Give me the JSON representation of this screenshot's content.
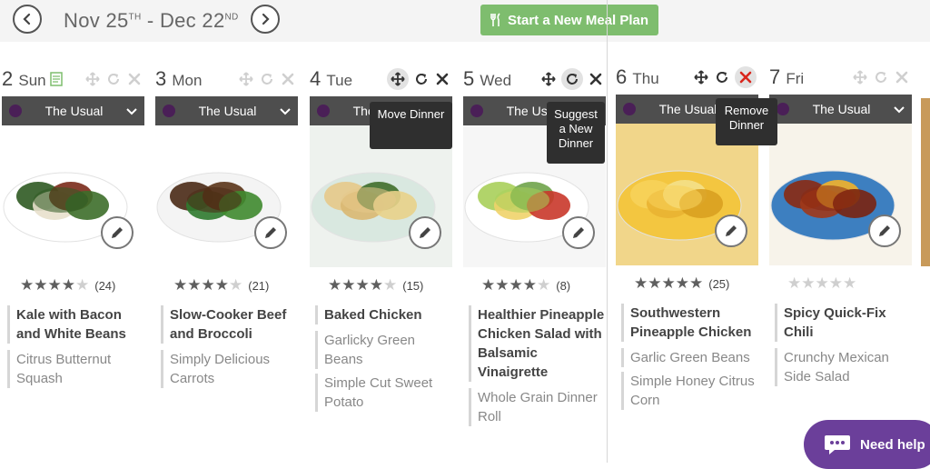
{
  "header": {
    "date_start_month": "Nov",
    "date_start_day": "25",
    "date_start_suffix": "TH",
    "separator": "-",
    "date_end_month": "Dec",
    "date_end_day": "22",
    "date_end_suffix": "ND",
    "new_plan_label": "Start a New Meal Plan"
  },
  "days": [
    {
      "num": "2",
      "name": "Sun",
      "plan": "The Usual",
      "rating": 4,
      "count": "(24)",
      "main": "Kale with Bacon and White Beans",
      "sides": [
        "Citrus Butternut Squash"
      ]
    },
    {
      "num": "3",
      "name": "Mon",
      "plan": "The Usual",
      "rating": 4,
      "count": "(21)",
      "main": "Slow-Cooker Beef and Broccoli",
      "sides": [
        "Simply Delicious Carrots"
      ]
    },
    {
      "num": "4",
      "name": "Tue",
      "plan": "The Usual",
      "rating": 4,
      "count": "(15)",
      "main": "Baked Chicken",
      "sides": [
        "Garlicky Green Beans",
        "Simple Cut Sweet Potato"
      ]
    },
    {
      "num": "5",
      "name": "Wed",
      "plan": "The Usual",
      "rating": 4,
      "count": "(8)",
      "main": "Healthier Pineapple Chicken Salad with Balsamic Vinaigrette",
      "sides": [
        "Whole Grain Dinner Roll"
      ]
    },
    {
      "num": "6",
      "name": "Thu",
      "plan": "The Usual",
      "rating": 4.5,
      "count": "(25)",
      "main": "Southwestern Pineapple Chicken",
      "sides": [
        "Garlic Green Beans",
        "Simple Honey Citrus Corn"
      ]
    },
    {
      "num": "7",
      "name": "Fri",
      "plan": "The Usual",
      "rating": 0,
      "count": "",
      "main": "Spicy Quick-Fix Chili",
      "sides": [
        "Crunchy Mexican Side Salad"
      ]
    }
  ],
  "tooltips": {
    "move": "Move Dinner",
    "suggest": "Suggest a New Dinner",
    "remove": "Remove Dinner"
  },
  "help": {
    "label": "Need help"
  },
  "colors": {
    "accent_green": "#7ebd6e",
    "help_purple": "#6b3f9a",
    "plan_bar": "#4e4e4e",
    "remove_red": "#d9261c"
  }
}
